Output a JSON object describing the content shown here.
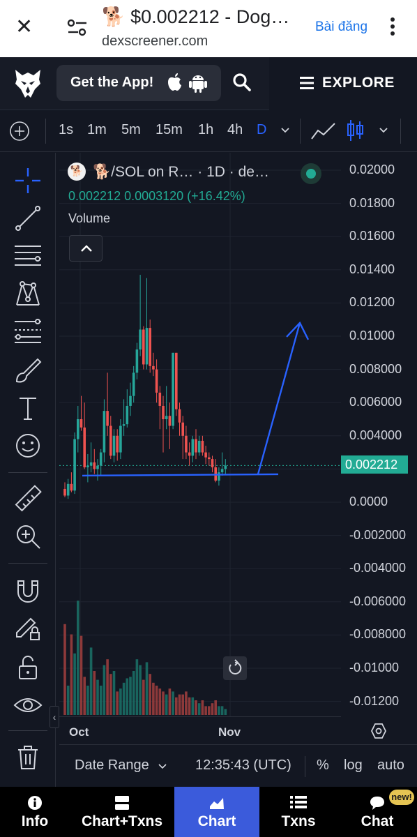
{
  "browser": {
    "close_icon": "close-icon",
    "title": "🐕 $0.002212 - Dog…",
    "url": "dexscreener.com",
    "post_label": "Bài đăng"
  },
  "header": {
    "get_app_label": "Get the App!",
    "explore_label": "EXPLORE"
  },
  "toolbar": {
    "timeframes": [
      "1s",
      "1m",
      "5m",
      "15m",
      "1h",
      "4h",
      "D"
    ],
    "active_timeframe": "D"
  },
  "legend": {
    "symbol": "🐕/SOL on R… · 1D · de…",
    "token_icon": "🐕",
    "ohlc": "0.002212  0.0003120 (+16.42%)",
    "volume_label": "Volume"
  },
  "chart_data": {
    "type": "candlestick",
    "title": "",
    "y_tick_labels": [
      "0.02000",
      "0.01800",
      "0.01600",
      "0.01400",
      "0.01200",
      "0.01000",
      "0.008000",
      "0.006000",
      "0.004000",
      "0.002212",
      "0.0000",
      "-0.002000",
      "-0.004000",
      "-0.006000",
      "-0.008000",
      "-0.01000",
      "-0.01200"
    ],
    "ylim": [
      -0.0128,
      0.0205
    ],
    "x_tick_labels": [
      "Oct",
      "Nov"
    ],
    "last_price": 0.002212,
    "price_line_color": "#22ab94",
    "up_color": "#26a69a",
    "down_color": "#ef5350",
    "candles": [
      [
        0.0008,
        0.0012,
        0.0003,
        0.0004
      ],
      [
        0.0004,
        0.0014,
        0.0002,
        0.0011
      ],
      [
        0.0011,
        0.0018,
        0.0006,
        0.0007
      ],
      [
        0.0007,
        0.0042,
        0.0005,
        0.0038
      ],
      [
        0.0038,
        0.0058,
        0.003,
        0.005
      ],
      [
        0.005,
        0.0064,
        0.0043,
        0.0045
      ],
      [
        0.0045,
        0.006,
        0.002,
        0.0021
      ],
      [
        0.0021,
        0.0029,
        0.0012,
        0.0022
      ],
      [
        0.0022,
        0.0036,
        0.0018,
        0.0024
      ],
      [
        0.0024,
        0.0032,
        0.0017,
        0.002
      ],
      [
        0.002,
        0.0026,
        0.0013,
        0.0022
      ],
      [
        0.0022,
        0.0032,
        0.0016,
        0.003
      ],
      [
        0.003,
        0.0062,
        0.0024,
        0.0055
      ],
      [
        0.0055,
        0.0078,
        0.004,
        0.0046
      ],
      [
        0.0046,
        0.0052,
        0.0026,
        0.0028
      ],
      [
        0.0028,
        0.0044,
        0.0024,
        0.004
      ],
      [
        0.004,
        0.0044,
        0.0025,
        0.003
      ],
      [
        0.003,
        0.005,
        0.0026,
        0.0046
      ],
      [
        0.0046,
        0.0062,
        0.004,
        0.0047
      ],
      [
        0.0047,
        0.0068,
        0.0045,
        0.0058
      ],
      [
        0.0058,
        0.0072,
        0.0052,
        0.0064
      ],
      [
        0.0064,
        0.0082,
        0.006,
        0.0078
      ],
      [
        0.0078,
        0.0096,
        0.0074,
        0.0092
      ],
      [
        0.0092,
        0.0137,
        0.0088,
        0.0104
      ],
      [
        0.0104,
        0.0106,
        0.008,
        0.0083
      ],
      [
        0.0083,
        0.0135,
        0.008,
        0.0105
      ],
      [
        0.0105,
        0.011,
        0.0078,
        0.0082
      ],
      [
        0.0082,
        0.009,
        0.0076,
        0.008
      ],
      [
        0.008,
        0.0086,
        0.006,
        0.0066
      ],
      [
        0.0066,
        0.007,
        0.0044,
        0.0058
      ],
      [
        0.0058,
        0.0064,
        0.003,
        0.005
      ],
      [
        0.005,
        0.007,
        0.0044,
        0.0052
      ],
      [
        0.0052,
        0.006,
        0.0032,
        0.0046
      ],
      [
        0.0046,
        0.009,
        0.0044,
        0.009
      ],
      [
        0.009,
        0.009,
        0.0052,
        0.0056
      ],
      [
        0.0056,
        0.006,
        0.004,
        0.0048
      ],
      [
        0.0048,
        0.0052,
        0.0026,
        0.004
      ],
      [
        0.004,
        0.0046,
        0.0026,
        0.003
      ],
      [
        0.003,
        0.0036,
        0.0022,
        0.0028
      ],
      [
        0.0028,
        0.004,
        0.0024,
        0.0038
      ],
      [
        0.0038,
        0.0044,
        0.0026,
        0.003
      ],
      [
        0.003,
        0.004,
        0.0028,
        0.0037
      ],
      [
        0.0037,
        0.004,
        0.0028,
        0.003
      ],
      [
        0.003,
        0.0034,
        0.0023,
        0.0027
      ],
      [
        0.0027,
        0.003,
        0.0022,
        0.0026
      ],
      [
        0.0026,
        0.0028,
        0.0018,
        0.0021
      ],
      [
        0.0021,
        0.0026,
        0.0012,
        0.0013
      ],
      [
        0.0013,
        0.0021,
        0.001,
        0.0018
      ],
      [
        0.0018,
        0.003,
        0.0016,
        0.002
      ],
      [
        0.002,
        0.0026,
        0.0017,
        0.0022
      ]
    ],
    "volumes": [
      0.62,
      0.2,
      0.55,
      0.42,
      0.78,
      0.54,
      0.26,
      0.2,
      0.46,
      0.3,
      0.24,
      0.2,
      0.34,
      0.38,
      0.28,
      0.3,
      0.16,
      0.18,
      0.22,
      0.25,
      0.26,
      0.3,
      0.38,
      0.34,
      0.24,
      0.36,
      0.28,
      0.22,
      0.2,
      0.18,
      0.16,
      0.14,
      0.18,
      0.16,
      0.12,
      0.14,
      0.14,
      0.16,
      0.12,
      0.12,
      0.1,
      0.08,
      0.1,
      0.06,
      0.06,
      0.08,
      0.1,
      0.06,
      0.06,
      0.04
    ],
    "support_line_y": 0.0016,
    "arrow_target_y": 0.0108
  },
  "controls": {
    "date_range_label": "Date Range",
    "clock": "12:35:43 (UTC)",
    "percent_label": "%",
    "log_label": "log",
    "auto_label": "auto"
  },
  "nav": {
    "items": [
      {
        "label": "Info"
      },
      {
        "label": "Chart+Txns"
      },
      {
        "label": "Chart"
      },
      {
        "label": "Txns"
      },
      {
        "label": "Chat"
      }
    ],
    "active": "Chart",
    "new_badge": "new!"
  }
}
